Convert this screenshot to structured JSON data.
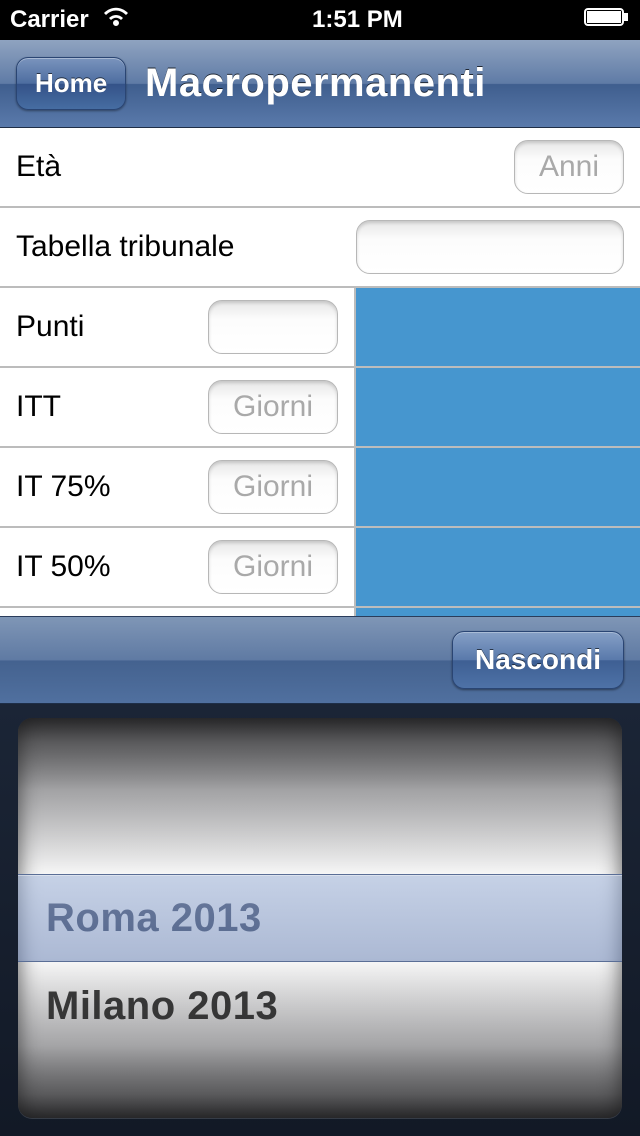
{
  "statusbar": {
    "carrier": "Carrier",
    "time": "1:51 PM"
  },
  "nav": {
    "home_label": "Home",
    "title": "Macropermanenti"
  },
  "form": {
    "eta": {
      "label": "Età",
      "placeholder": "Anni"
    },
    "tribunale": {
      "label": "Tabella tribunale",
      "placeholder": ""
    },
    "punti": {
      "label": "Punti",
      "placeholder": ""
    },
    "itt": {
      "label": "ITT",
      "placeholder": "Giorni"
    },
    "it75": {
      "label": "IT 75%",
      "placeholder": "Giorni"
    },
    "it50": {
      "label": "IT 50%",
      "placeholder": "Giorni"
    }
  },
  "toolbar": {
    "hide_label": "Nascondi"
  },
  "picker": {
    "selected": "Roma 2013",
    "options": [
      "Roma 2013",
      "Milano 2013"
    ]
  }
}
